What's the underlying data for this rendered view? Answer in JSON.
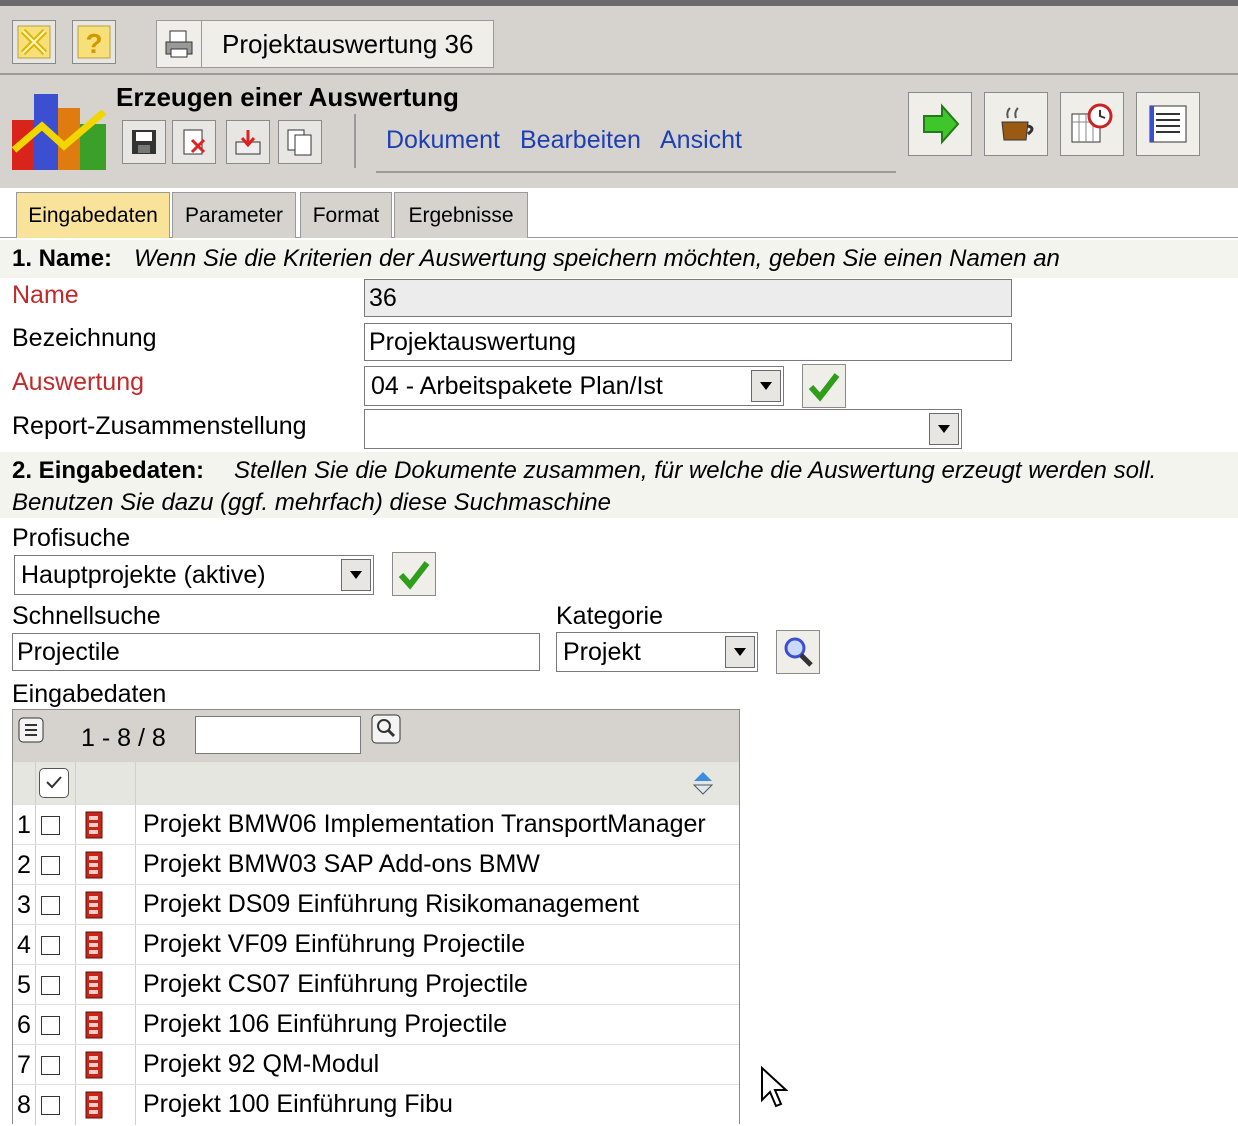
{
  "window": {
    "title": "Projektauswertung 36"
  },
  "header": {
    "title": "Erzeugen einer Auswertung",
    "menu": [
      "Dokument",
      "Bearbeiten",
      "Ansicht"
    ]
  },
  "tabs": [
    "Eingabedaten",
    "Parameter",
    "Format",
    "Ergebnisse"
  ],
  "section1": {
    "heading": "1. Name:",
    "hint": "Wenn Sie die Kriterien der Auswertung speichern möchten, geben Sie einen Namen an"
  },
  "form": {
    "name_label": "Name",
    "name_value": "36",
    "bez_label": "Bezeichnung",
    "bez_value": "Projektauswertung",
    "ausw_label": "Auswertung",
    "ausw_value": "04 - Arbeitspakete Plan/Ist",
    "report_label": "Report-Zusammenstellung",
    "report_value": ""
  },
  "section2": {
    "heading": "2. Eingabedaten:",
    "hint1": "Stellen Sie die Dokumente zusammen, für welche die Auswertung erzeugt werden soll.",
    "hint2": "Benutzen Sie dazu (ggf. mehrfach) diese Suchmaschine"
  },
  "search": {
    "profi_label": "Profisuche",
    "profi_value": "Hauptprojekte (aktive)",
    "schnell_label": "Schnellsuche",
    "schnell_value": "Projectile",
    "kategorie_label": "Kategorie",
    "kategorie_value": "Projekt",
    "eingabedaten_label": "Eingabedaten"
  },
  "grid": {
    "count": "1 - 8 / 8",
    "filter_value": "",
    "rows": [
      {
        "num": "1",
        "text": "Projekt BMW06 Implementation TransportManager"
      },
      {
        "num": "2",
        "text": "Projekt BMW03 SAP Add-ons BMW"
      },
      {
        "num": "3",
        "text": "Projekt DS09 Einführung Risikomanagement"
      },
      {
        "num": "4",
        "text": "Projekt VF09 Einführung Projectile"
      },
      {
        "num": "5",
        "text": "Projekt CS07 Einführung Projectile"
      },
      {
        "num": "6",
        "text": "Projekt 106 Einführung Projectile"
      },
      {
        "num": "7",
        "text": "Projekt 92 QM-Modul"
      },
      {
        "num": "8",
        "text": "Projekt 100 Einführung Fibu"
      }
    ]
  }
}
